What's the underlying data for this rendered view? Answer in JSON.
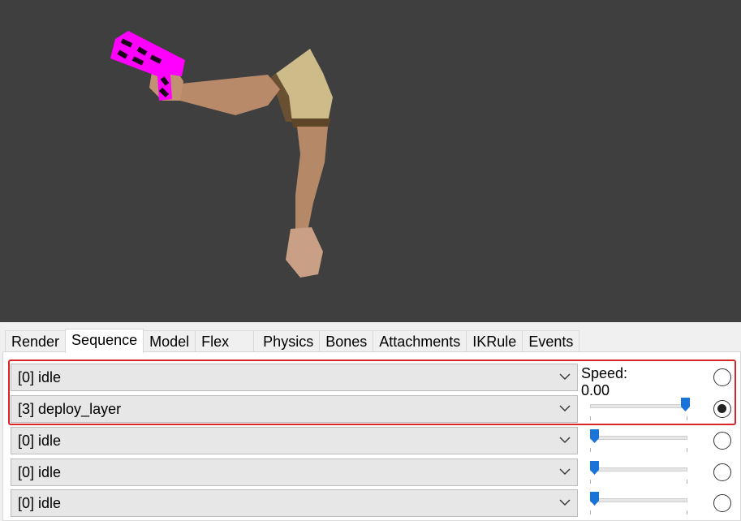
{
  "viewport": {
    "label": "3D model viewport",
    "background": "#3f3f3f",
    "weapon_color": "#ff00ff"
  },
  "tabs": [
    {
      "label": "Render",
      "active": false
    },
    {
      "label": "Sequence",
      "active": true
    },
    {
      "label": "Model",
      "active": false
    },
    {
      "label": "Flex",
      "active": false
    },
    {
      "label": "Physics",
      "active": false
    },
    {
      "label": "Bones",
      "active": false
    },
    {
      "label": "Attachments",
      "active": false
    },
    {
      "label": "IKRule",
      "active": false
    },
    {
      "label": "Events",
      "active": false
    }
  ],
  "sequence": {
    "speed_label": "Speed: 0.00",
    "rows": [
      {
        "value": "[0] idle",
        "selected": false,
        "slider": null
      },
      {
        "value": "[3] deploy_layer",
        "selected": true,
        "slider": 1.0
      },
      {
        "value": "[0] idle",
        "selected": false,
        "slider": 0.0
      },
      {
        "value": "[0] idle",
        "selected": false,
        "slider": 0.0
      },
      {
        "value": "[0] idle",
        "selected": false,
        "slider": 0.0
      }
    ]
  },
  "colors": {
    "highlight": "#d7262b",
    "slider_thumb": "#1a73d9"
  },
  "icons": {
    "dropdown": "chevron-down-icon"
  }
}
